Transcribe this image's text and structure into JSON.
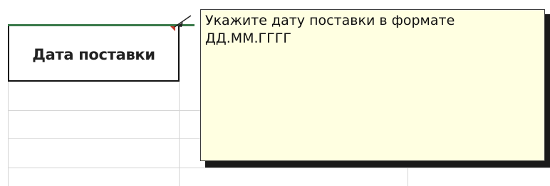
{
  "sheet": {
    "header_cell_label": "Дата поставки"
  },
  "comment": {
    "text": "Укажите дату поставки в формате ДД.ММ.ГГГГ"
  },
  "colors": {
    "header_top_border": "#3a7a4a",
    "comment_background": "#ffffe1",
    "comment_marker": "#c0392b",
    "gridline": "#d4d4d4"
  }
}
